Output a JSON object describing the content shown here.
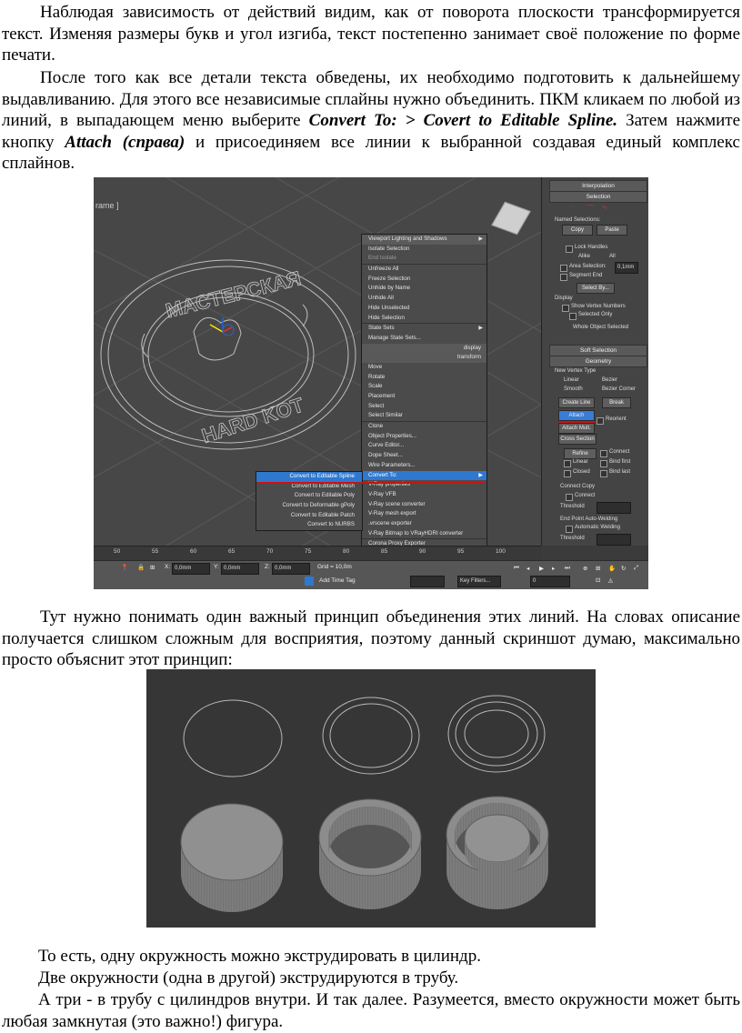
{
  "text": {
    "p1": "Наблюдая зависимость от действий видим, как от поворота плоскости трансформируется текст. Изменяя размеры букв и угол изгиба, текст постепенно занимает своё положение по форме печати.",
    "p2_part1": "После того как все детали текста обведены, их необходимо подготовить к дальнейшему выдавливанию. Для этого все независимые сплайны нужно объединить. ПКМ кликаем по любой из линий, в выпадающем меню выберите ",
    "p2_bold1": "Convert To: > Covert to Editable Spline.",
    "p2_part2": " Затем нажмите кнопку ",
    "p2_bold2": "Attach (справа)",
    "p2_part3": " и присоединяем все линии к выбранной создавая единый комплекс сплайнов.",
    "p3": "Тут нужно понимать один важный принцип объединения этих линий. На словах описание получается слишком сложным для восприятия, поэтому данный скриншот думаю, максимально просто объяснит этот принцип:",
    "l1": "То есть, одну окружность можно экструдировать в цилиндр.",
    "l2": "Две окружности (одна в другой) экструдируются в трубу.",
    "l3": "А три - в трубу с цилиндров внутри. И так далее. Разумеется, вместо окружности может быть любая замкнутая (это важно!) фигура."
  },
  "screenshot1": {
    "viewport_label": "rame ]",
    "stamp_text_top": "МАСТЕРСКАЯ",
    "stamp_text_bottom": "HARD KOT",
    "menu_right": [
      {
        "label": "Viewport Lighting and Shadows",
        "arrow": true,
        "head": true
      },
      {
        "label": "Isolate Selection"
      },
      {
        "label": "End Isolate",
        "dim": true
      },
      {
        "label": "Unfreeze All",
        "sep": true
      },
      {
        "label": "Freeze Selection"
      },
      {
        "label": "Unhide by Name"
      },
      {
        "label": "Unhide All"
      },
      {
        "label": "Hide Unselected"
      },
      {
        "label": "Hide Selection"
      },
      {
        "label": "State Sets",
        "arrow": true,
        "sep": true
      },
      {
        "label": "Manage State Sets..."
      },
      {
        "label": "display",
        "rlabel": true
      },
      {
        "label": "transform",
        "rlabel": true
      },
      {
        "label": "Move"
      },
      {
        "label": "Rotate"
      },
      {
        "label": "Scale"
      },
      {
        "label": "Placement"
      },
      {
        "label": "Select"
      },
      {
        "label": "Select Similar"
      },
      {
        "label": "Clone",
        "sep": true
      },
      {
        "label": "Object Properties..."
      },
      {
        "label": "Curve Editor..."
      },
      {
        "label": "Dope Sheet..."
      },
      {
        "label": "Wire Parameters..."
      },
      {
        "label": "Convert To:",
        "arrow": true,
        "hl": true
      },
      {
        "label": "V-Ray properties"
      },
      {
        "label": "V-Ray VFB"
      },
      {
        "label": "V-Ray scene converter"
      },
      {
        "label": "V-Ray mesh export"
      },
      {
        "label": ".vrscene exporter"
      },
      {
        "label": "V-Ray Bitmap to VRayHDRI converter"
      },
      {
        "label": "Corona Proxy Exporter",
        "sep": true
      },
      {
        "label": "Corona Converter"
      },
      {
        "label": "Redshift Object Properties..."
      },
      {
        "label": "Redshift Proxy Export..."
      }
    ],
    "menu_left": [
      {
        "label": "Convert to Editable Spline",
        "hl": true
      },
      {
        "label": "Convert to Editable Mesh"
      },
      {
        "label": "Convert to Editable Poly"
      },
      {
        "label": "Convert to Deformable gPoly"
      },
      {
        "label": "Convert to Editable Patch"
      },
      {
        "label": "Convert to NURBS"
      }
    ],
    "panel": {
      "interpolation": "Interpolation",
      "selection": "Selection",
      "named_sel": "Named Selections:",
      "copy": "Copy",
      "paste": "Paste",
      "lock_handles": "Lock Handles",
      "alike": "Alike",
      "all": "All",
      "area_selection": "Area Selection:",
      "area_value": "0,1mm",
      "segment_end": "Segment End",
      "select_by": "Select By...",
      "display": "Display",
      "show_vertex_numbers": "Show Vertex Numbers",
      "selected_only": "Selected Only",
      "whole_object_selected": "Whole Object Selected",
      "soft_selection": "Soft Selection",
      "geometry": "Geometry",
      "new_vertex_type": "New Vertex Type",
      "linear": "Linear",
      "bezier": "Bezier",
      "smooth": "Smooth",
      "bezier_corner": "Bezier Corner",
      "create_line": "Create Line",
      "break": "Break",
      "attach": "Attach",
      "reorient": "Reorient",
      "attach_mult": "Attach Mult.",
      "cross_section": "Cross Section",
      "refine": "Refine",
      "connect": "Connect",
      "bind_first": "Bind first",
      "closed": "Closed",
      "bind_last": "Bind last",
      "connect_copy": "Connect Copy",
      "connect2": "Connect",
      "threshold": "Threshold",
      "end_point_welding": "End Point Auto-Welding",
      "automatic_welding": "Automatic Welding",
      "threshold2": "Threshold",
      "weld": "Weld"
    },
    "timeline_ticks": [
      "50",
      "55",
      "60",
      "65",
      "70",
      "75",
      "80",
      "85",
      "90",
      "95",
      "100"
    ],
    "status": {
      "x_label": "X:",
      "x_value": "0,0mm",
      "y_label": "Y:",
      "y_value": "0,0mm",
      "z_label": "Z:",
      "z_value": "0,0mm",
      "grid": "Grid = 10,0m",
      "add_time_tag": "Add Time Tag",
      "key_filters": "Key Filters...",
      "frame": "0"
    }
  },
  "screenshot2": {
    "description_colors": {
      "bg": "#363636",
      "solid": "#8a8a8a",
      "line": "#b8b8b8"
    }
  }
}
